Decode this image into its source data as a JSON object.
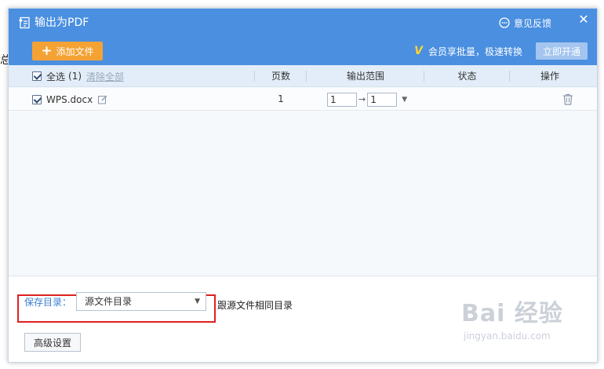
{
  "edge_text": "总",
  "window": {
    "title": "输出为PDF",
    "feedback_label": "意见反馈",
    "close_glyph": "✕"
  },
  "toolbar": {
    "add_button_plus": "+",
    "add_button_label": "添加文件",
    "vip_icon_glyph": "V",
    "vip_text": "会员享批量，极速转换",
    "open_button_label": "立即开通"
  },
  "table": {
    "select_all_label": "全选",
    "selected_count": "(1)",
    "clear_all_label": "清除全部",
    "columns": [
      "页数",
      "输出范围",
      "状态",
      "操作"
    ],
    "rows": [
      {
        "filename": "WPS.docx",
        "pages": "1",
        "range_from": "1",
        "range_arrow": "→",
        "range_to": "1",
        "status": ""
      }
    ]
  },
  "footer": {
    "save_dir_label": "保存目录：",
    "save_dir_value": "源文件目录",
    "save_dir_hint": "跟源文件相同目录",
    "advanced_button_label": "高级设置"
  },
  "watermark": {
    "brand": "Bai 经验",
    "url": "jingyan.baidu.com"
  },
  "colors": {
    "title_bar": "#4a8fe0",
    "add_button": "#f5a234",
    "open_button": "#a4c5ef",
    "highlight_border": "#e02020",
    "link": "#3a7fd2"
  }
}
